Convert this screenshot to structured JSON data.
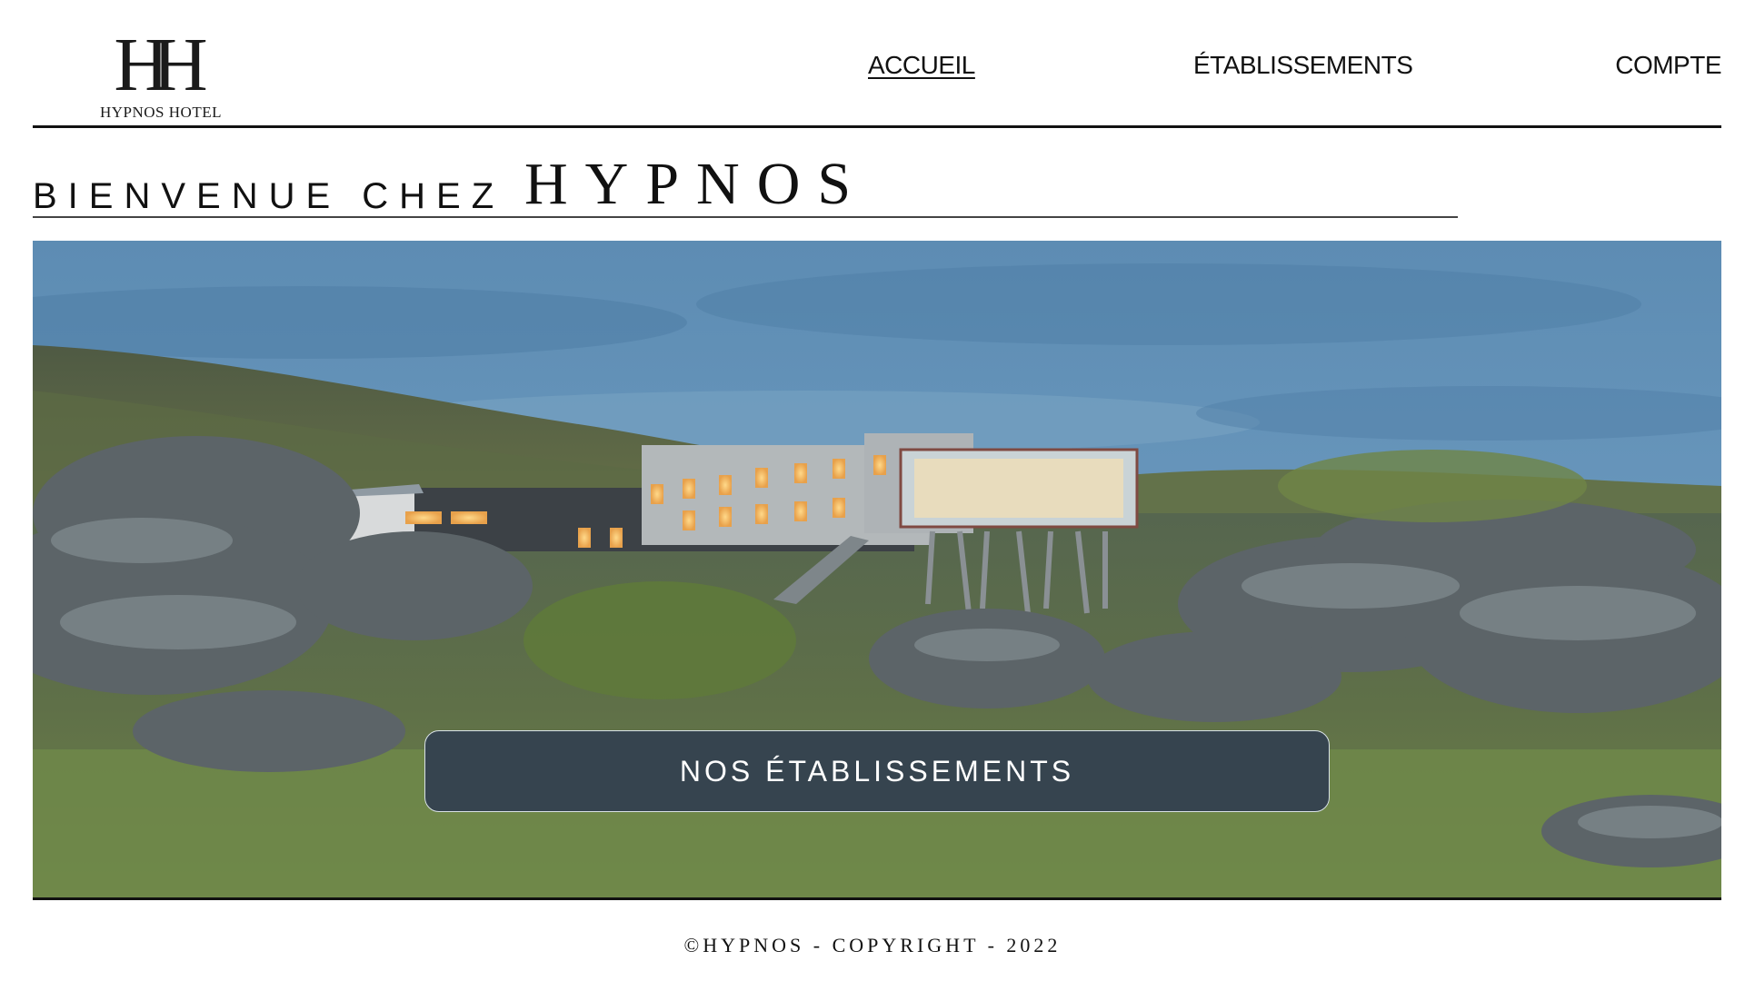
{
  "brand": {
    "logo_mark": "HH",
    "logo_text": "HYPNOS HOTEL"
  },
  "nav": {
    "items": [
      {
        "label": "ACCUEIL",
        "active": true
      },
      {
        "label": "ÉTABLISSEMENTS",
        "active": false
      },
      {
        "label": "COMPTE",
        "active": false
      }
    ]
  },
  "welcome": {
    "prefix": "BIENVENUE CHEZ",
    "brand": "HYPNOS"
  },
  "hero": {
    "image_alt": "Hotel building among mossy rocks at dusk",
    "cta_label": "NOS ÉTABLISSEMENTS"
  },
  "footer": {
    "text": "©HYPNOS - COPYRIGHT - 2022"
  },
  "colors": {
    "button_bg": "#36444f",
    "text": "#111111",
    "sky": "#5b87ab"
  }
}
